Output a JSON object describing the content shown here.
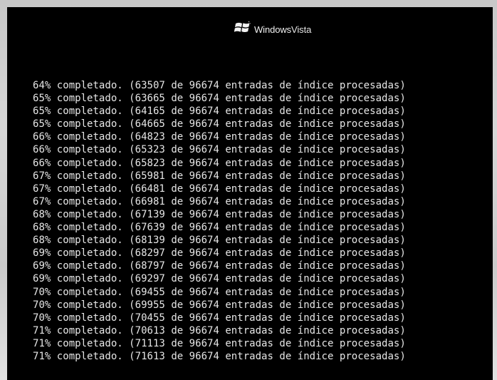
{
  "logo": {
    "word_bold": "Windows",
    "word_light": "Vista",
    "icon": "windows-flag-icon"
  },
  "console_lines": [
    "64% completado. (63507 de 96674 entradas de índice procesadas)",
    "65% completado. (63665 de 96674 entradas de índice procesadas)",
    "65% completado. (64165 de 96674 entradas de índice procesadas)",
    "65% completado. (64665 de 96674 entradas de índice procesadas)",
    "66% completado. (64823 de 96674 entradas de índice procesadas)",
    "66% completado. (65323 de 96674 entradas de índice procesadas)",
    "66% completado. (65823 de 96674 entradas de índice procesadas)",
    "67% completado. (65981 de 96674 entradas de índice procesadas)",
    "67% completado. (66481 de 96674 entradas de índice procesadas)",
    "67% completado. (66981 de 96674 entradas de índice procesadas)",
    "68% completado. (67139 de 96674 entradas de índice procesadas)",
    "68% completado. (67639 de 96674 entradas de índice procesadas)",
    "68% completado. (68139 de 96674 entradas de índice procesadas)",
    "69% completado. (68297 de 96674 entradas de índice procesadas)",
    "69% completado. (68797 de 96674 entradas de índice procesadas)",
    "69% completado. (69297 de 96674 entradas de índice procesadas)",
    "70% completado. (69455 de 96674 entradas de índice procesadas)",
    "70% completado. (69955 de 96674 entradas de índice procesadas)",
    "70% completado. (70455 de 96674 entradas de índice procesadas)",
    "71% completado. (70613 de 96674 entradas de índice procesadas)",
    "71% completado. (71113 de 96674 entradas de índice procesadas)",
    "71% completado. (71613 de 96674 entradas de índice procesadas)"
  ],
  "colors": {
    "screen_background": "#000000",
    "text": "#e6e6e6",
    "frame": "#d0d0d0"
  }
}
